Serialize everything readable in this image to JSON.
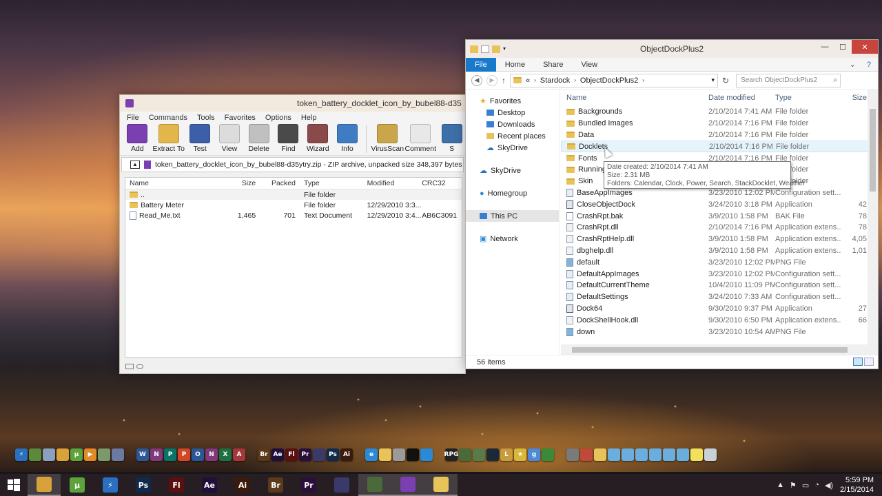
{
  "winrar": {
    "title": "token_battery_docklet_icon_by_bubel88-d35",
    "menu": [
      "File",
      "Commands",
      "Tools",
      "Favorites",
      "Options",
      "Help"
    ],
    "toolbar": [
      {
        "label": "Add",
        "icon": "archive-add-icon",
        "color": "#7a3fb0"
      },
      {
        "label": "Extract To",
        "icon": "extract-folder-icon",
        "color": "#e2b64a"
      },
      {
        "label": "Test",
        "icon": "test-icon",
        "color": "#3d5fa8"
      },
      {
        "label": "View",
        "icon": "glasses-icon",
        "color": "#dcdcdc"
      },
      {
        "label": "Delete",
        "icon": "delete-icon",
        "color": "#c0c0c0"
      },
      {
        "label": "Find",
        "icon": "binoculars-icon",
        "color": "#4a4a4a"
      },
      {
        "label": "Wizard",
        "icon": "wizard-icon",
        "color": "#8a4a4a"
      },
      {
        "label": "Info",
        "icon": "info-icon",
        "color": "#3f7cc4"
      },
      {
        "label": "VirusScan",
        "icon": "virus-scan-icon",
        "color": "#c9a64a"
      },
      {
        "label": "Comment",
        "icon": "comment-icon",
        "color": "#e8e8e8"
      },
      {
        "label": "S",
        "icon": "sfx-icon",
        "color": "#3d6fa8"
      }
    ],
    "path": "token_battery_docklet_icon_by_bubel88-d35ytry.zip - ZIP archive, unpacked size 348,397 bytes",
    "columns": {
      "name": "Name",
      "size": "Size",
      "packed": "Packed",
      "type": "Type",
      "modified": "Modified",
      "crc": "CRC32"
    },
    "rows": [
      {
        "name": "..",
        "size": "",
        "packed": "",
        "type": "File folder",
        "modified": "",
        "crc": "",
        "kind": "folder"
      },
      {
        "name": "Battery Meter",
        "size": "",
        "packed": "",
        "type": "File folder",
        "modified": "12/29/2010 3:3...",
        "crc": "",
        "kind": "folder"
      },
      {
        "name": "Read_Me.txt",
        "size": "1,465",
        "packed": "701",
        "type": "Text Document",
        "modified": "12/29/2010 3:4...",
        "crc": "AB6C3091",
        "kind": "doc"
      }
    ]
  },
  "explorer": {
    "title": "ObjectDockPlus2",
    "ribbon_tabs": [
      "File",
      "Home",
      "Share",
      "View"
    ],
    "breadcrumb": [
      "«",
      "Stardock",
      "ObjectDockPlus2"
    ],
    "search_placeholder": "Search ObjectDockPlus2",
    "nav": {
      "favorites": "Favorites",
      "favorites_items": [
        "Desktop",
        "Downloads",
        "Recent places",
        "SkyDrive"
      ],
      "skydrive": "SkyDrive",
      "homegroup": "Homegroup",
      "thispc": "This PC",
      "network": "Network"
    },
    "columns": {
      "name": "Name",
      "date": "Date modified",
      "type": "Type",
      "size": "Size"
    },
    "files": [
      {
        "name": "Backgrounds",
        "date": "2/10/2014 7:41 AM",
        "type": "File folder",
        "size": "",
        "kind": "folder"
      },
      {
        "name": "Bundled Images",
        "date": "2/10/2014 7:16 PM",
        "type": "File folder",
        "size": "",
        "kind": "folder"
      },
      {
        "name": "Data",
        "date": "2/10/2014 7:16 PM",
        "type": "File folder",
        "size": "",
        "kind": "folder"
      },
      {
        "name": "Docklets",
        "date": "2/10/2014 7:16 PM",
        "type": "File folder",
        "size": "",
        "kind": "folder"
      },
      {
        "name": "Fonts",
        "date": "2/10/2014 7:16 PM",
        "type": "File folder",
        "size": "",
        "kind": "folder"
      },
      {
        "name": "Running",
        "date": "2/10/2014 7:16 PM",
        "type": "File folder",
        "size": "",
        "kind": "folder"
      },
      {
        "name": "Skin",
        "date": "2/10/2014 7:16 PM",
        "type": "File folder",
        "size": "",
        "kind": "folder"
      },
      {
        "name": "BaseAppImages",
        "date": "3/23/2010 12:02 PM",
        "type": "Configuration sett...",
        "size": "",
        "kind": "cfg"
      },
      {
        "name": "CloseObjectDock",
        "date": "3/24/2010 3:18 PM",
        "type": "Application",
        "size": "42",
        "kind": "app"
      },
      {
        "name": "CrashRpt.bak",
        "date": "3/9/2010 1:58 PM",
        "type": "BAK File",
        "size": "78",
        "kind": "doc"
      },
      {
        "name": "CrashRpt.dll",
        "date": "2/10/2014 7:16 PM",
        "type": "Application extens...",
        "size": "78",
        "kind": "dll"
      },
      {
        "name": "CrashRptHelp.dll",
        "date": "3/9/2010 1:58 PM",
        "type": "Application extens...",
        "size": "4,05",
        "kind": "dll"
      },
      {
        "name": "dbghelp.dll",
        "date": "3/9/2010 1:58 PM",
        "type": "Application extens...",
        "size": "1,01",
        "kind": "dll"
      },
      {
        "name": "default",
        "date": "3/23/2010 12:02 PM",
        "type": "PNG File",
        "size": "",
        "kind": "img"
      },
      {
        "name": "DefaultAppImages",
        "date": "3/23/2010 12:02 PM",
        "type": "Configuration sett...",
        "size": "",
        "kind": "cfg"
      },
      {
        "name": "DefaultCurrentTheme",
        "date": "10/4/2010 11:09 PM",
        "type": "Configuration sett...",
        "size": "",
        "kind": "cfg"
      },
      {
        "name": "DefaultSettings",
        "date": "3/24/2010 7:33 AM",
        "type": "Configuration sett...",
        "size": "",
        "kind": "cfg"
      },
      {
        "name": "Dock64",
        "date": "9/30/2010 9:37 PM",
        "type": "Application",
        "size": "27",
        "kind": "app"
      },
      {
        "name": "DockShellHook.dll",
        "date": "9/30/2010 6:50 PM",
        "type": "Application extens...",
        "size": "66",
        "kind": "dll"
      },
      {
        "name": "down",
        "date": "3/23/2010 10:54 AM",
        "type": "PNG File",
        "size": "",
        "kind": "img"
      }
    ],
    "tooltip": {
      "created": "Date created: 2/10/2014 7:41 AM",
      "size": "Size: 2.31 MB",
      "folders": "Folders: Calendar, Clock, Power, Search, StackDocklet, Weather"
    },
    "status": "56 items"
  },
  "dock": {
    "icons": [
      {
        "name": "stardock-icon",
        "label": "⚡",
        "color": "#2b6fc0"
      },
      {
        "name": "minecraft-icon",
        "label": "",
        "color": "#5a8a3a"
      },
      {
        "name": "paint-icon",
        "label": "",
        "color": "#8aa0c0"
      },
      {
        "name": "chrome-icon",
        "label": "",
        "color": "#d8a23a"
      },
      {
        "name": "utorrent-icon",
        "label": "µ",
        "color": "#5da33b"
      },
      {
        "name": "media-icon",
        "label": "▶",
        "color": "#e08a2a"
      },
      {
        "name": "tools-icon",
        "label": "",
        "color": "#7a9a6a"
      },
      {
        "name": "app-icon",
        "label": "",
        "color": "#6a7aa0"
      },
      {
        "name": "word-icon",
        "label": "W",
        "color": "#2b5797"
      },
      {
        "name": "onenote-icon",
        "label": "N",
        "color": "#80397b"
      },
      {
        "name": "publisher-icon",
        "label": "P",
        "color": "#077568"
      },
      {
        "name": "powerpoint-icon",
        "label": "P",
        "color": "#d24726"
      },
      {
        "name": "onenote2-icon",
        "label": "O",
        "color": "#2b5797"
      },
      {
        "name": "onenote3-icon",
        "label": "N",
        "color": "#80397b"
      },
      {
        "name": "excel-icon",
        "label": "X",
        "color": "#1e7145"
      },
      {
        "name": "access-icon",
        "label": "A",
        "color": "#a4373a"
      },
      {
        "name": "bridge-icon",
        "label": "Br",
        "color": "#5a3a1a"
      },
      {
        "name": "after-effects-icon",
        "label": "Ae",
        "color": "#1f0f3a"
      },
      {
        "name": "flash-icon",
        "label": "Fl",
        "color": "#5a1010"
      },
      {
        "name": "premiere-icon",
        "label": "Pr",
        "color": "#2a0f3a"
      },
      {
        "name": "encore-icon",
        "label": "",
        "color": "#3a3a6a"
      },
      {
        "name": "photoshop-icon",
        "label": "Ps",
        "color": "#0f2a4a"
      },
      {
        "name": "illustrator-icon",
        "label": "Ai",
        "color": "#3a1a0a"
      },
      {
        "name": "ie-icon",
        "label": "e",
        "color": "#2a8ad8"
      },
      {
        "name": "explorer-icon",
        "label": "",
        "color": "#e8c35a"
      },
      {
        "name": "control-icon",
        "label": "",
        "color": "#9a9a9a"
      },
      {
        "name": "cmd-icon",
        "label": "",
        "color": "#111111"
      },
      {
        "name": "network-icon",
        "label": "",
        "color": "#2a8ad8"
      },
      {
        "name": "stick-rpg-icon",
        "label": "RPG",
        "color": "#222222"
      },
      {
        "name": "game1-icon",
        "label": "",
        "color": "#4a6a3a"
      },
      {
        "name": "game2-icon",
        "label": "",
        "color": "#5a7a4a"
      },
      {
        "name": "steam-icon",
        "label": "",
        "color": "#1b2838"
      },
      {
        "name": "league-icon",
        "label": "L",
        "color": "#c89b3c"
      },
      {
        "name": "star-icon",
        "label": "★",
        "color": "#d8b83a"
      },
      {
        "name": "gimp-icon",
        "label": "g",
        "color": "#4a8ad8"
      },
      {
        "name": "plant-icon",
        "label": "",
        "color": "#3a8a3a"
      },
      {
        "name": "printer-icon",
        "label": "",
        "color": "#7a7a7a"
      },
      {
        "name": "books-icon",
        "label": "",
        "color": "#c04a3a"
      },
      {
        "name": "folder-icon",
        "label": "",
        "color": "#e8c35a"
      },
      {
        "name": "tile1-icon",
        "label": "",
        "color": "#6aaee0"
      },
      {
        "name": "tile2-icon",
        "label": "",
        "color": "#6aaee0"
      },
      {
        "name": "tile3-icon",
        "label": "",
        "color": "#6aaee0"
      },
      {
        "name": "tile4-icon",
        "label": "",
        "color": "#6aaee0"
      },
      {
        "name": "tile5-icon",
        "label": "",
        "color": "#6aaee0"
      },
      {
        "name": "tile6-icon",
        "label": "",
        "color": "#6aaee0"
      },
      {
        "name": "notes-icon",
        "label": "",
        "color": "#f0e05a"
      },
      {
        "name": "recycle-bin-icon",
        "label": "",
        "color": "#c8d0d8"
      }
    ]
  },
  "taskbar": {
    "apps": [
      {
        "name": "chrome-icon",
        "label": "",
        "color": "#d8a23a",
        "active": true
      },
      {
        "name": "utorrent-icon",
        "label": "µ",
        "color": "#5da33b",
        "active": false
      },
      {
        "name": "stardock-icon",
        "label": "⚡",
        "color": "#2b6fc0",
        "active": false
      },
      {
        "name": "photoshop-icon",
        "label": "Ps",
        "color": "#0f2a4a",
        "active": false
      },
      {
        "name": "flash-icon",
        "label": "Fl",
        "color": "#5a1010",
        "active": false
      },
      {
        "name": "after-effects-icon",
        "label": "Ae",
        "color": "#1f0f3a",
        "active": false
      },
      {
        "name": "illustrator-icon",
        "label": "Ai",
        "color": "#3a1a0a",
        "active": false
      },
      {
        "name": "bridge-icon",
        "label": "Br",
        "color": "#5a3a1a",
        "active": false
      },
      {
        "name": "premiere-icon",
        "label": "Pr",
        "color": "#2a0f3a",
        "active": false
      },
      {
        "name": "encore-icon",
        "label": "",
        "color": "#3a3a6a",
        "active": false
      },
      {
        "name": "stick-icon",
        "label": "",
        "color": "#4a6a3a",
        "active": true
      },
      {
        "name": "winrar-icon",
        "label": "",
        "color": "#7a3fb0",
        "active": true
      },
      {
        "name": "file-explorer-icon",
        "label": "",
        "color": "#e8c35a",
        "active": true
      }
    ],
    "time": "5:59 PM",
    "date": "2/15/2014"
  }
}
